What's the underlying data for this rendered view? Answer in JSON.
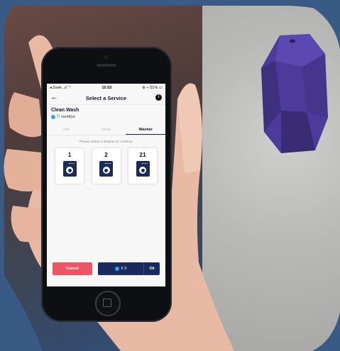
{
  "phone": {
    "status_bar": {
      "carrier": "◂ Zoek ..ıl ⌔",
      "time": "15:53",
      "battery": "⊛ ⌁ 51% ▭"
    },
    "nav": {
      "back_icon": "arrow-left-icon",
      "title": "Select a Service",
      "info_icon": "info-icon"
    },
    "shop": {
      "name": "Clean Wash",
      "credit_value": "0",
      "credit_label": "credit(s)"
    },
    "tabs": [
      {
        "label": "Iron",
        "active": false
      },
      {
        "label": "Dryer",
        "active": false
      },
      {
        "label": "Washer",
        "active": true
      }
    ],
    "hint": "Please select a Washer to continue",
    "machines": [
      {
        "number": "1",
        "icon": "washing-machine-icon"
      },
      {
        "number": "2",
        "icon": "washing-machine-icon"
      },
      {
        "number": "21",
        "icon": "washing-machine-icon"
      }
    ],
    "actions": {
      "cancel_label": "Cancel",
      "price": "€ 3",
      "ok_label": "Ok"
    }
  },
  "colors": {
    "navy": "#1b2a5c",
    "cancel_red": "#ec5566",
    "credit_blue": "#36a3e6",
    "beacon_purple": "#4d3b9c",
    "frame_blue": "#3a5a86"
  }
}
